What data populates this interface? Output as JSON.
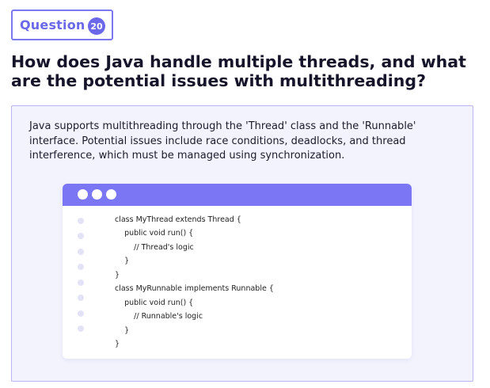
{
  "badge": {
    "label": "Question",
    "number": "20"
  },
  "question": {
    "title": "How does Java handle multiple threads, and what are the potential issues with multithreading?"
  },
  "answer": {
    "text": "Java supports multithreading through the 'Thread' class and the 'Runnable' interface. Potential issues include race conditions, deadlocks, and thread interference, which must be managed using synchronization."
  },
  "code": {
    "lines": [
      "class MyThread extends Thread {",
      "    public void run() {",
      "        // Thread's logic",
      "    }",
      "}",
      "class MyRunnable implements Runnable {",
      "    public void run() {",
      "        // Runnable's logic",
      "    }",
      "}"
    ]
  },
  "colors": {
    "accent": "#6b68ea",
    "window_header": "#7b77f4",
    "card_background": "#f3f3fd",
    "card_border": "#b9b6f2",
    "title_text": "#16142a"
  }
}
